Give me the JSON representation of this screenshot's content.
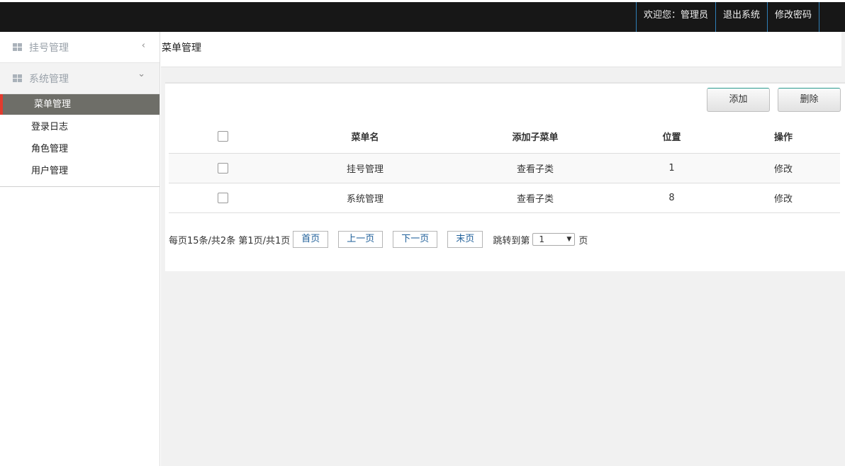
{
  "header": {
    "links": [
      "欢迎您：管理员",
      "退出系统",
      "修改密码"
    ]
  },
  "sidebar": {
    "groups": [
      {
        "label": "挂号管理",
        "chevron": "‹"
      },
      {
        "label": "系统管理",
        "chevron": "⌄"
      }
    ],
    "items": [
      {
        "label": "菜单管理",
        "active": true
      },
      {
        "label": "登录日志"
      },
      {
        "label": "角色管理"
      },
      {
        "label": "用户管理"
      }
    ]
  },
  "breadcrumb": "菜单管理",
  "toolbar": {
    "add_label": "添加",
    "delete_label": "删除"
  },
  "table": {
    "headers": [
      "菜单名",
      "添加子菜单",
      "位置",
      "操作"
    ],
    "rows": [
      {
        "name": "挂号管理",
        "sub": "查看子类",
        "position": "1",
        "action": "修改"
      },
      {
        "name": "系统管理",
        "sub": "查看子类",
        "position": "8",
        "action": "修改"
      }
    ]
  },
  "pager": {
    "summary": "每页15条/共2条 第1页/共1页",
    "first": "首页",
    "prev": "上一页",
    "next": "下一页",
    "last": "末页",
    "jump_label": "跳转到第",
    "page_value": "1",
    "page_unit": "页"
  },
  "colors": {
    "topbar": "#171717",
    "active_item": "#6e6e68",
    "active_marker": "#e23b2e",
    "link_blue": "#1f5f99"
  }
}
